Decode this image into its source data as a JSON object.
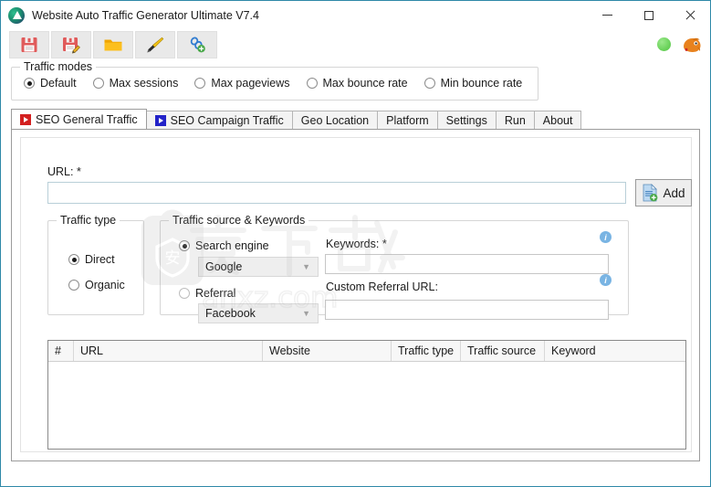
{
  "window": {
    "title": "Website Auto Traffic Generator Ultimate V7.4",
    "app_icon": "app-logo-icon",
    "minimize_label": "—",
    "maximize_label": "□",
    "close_label": "✕"
  },
  "toolbar": {
    "buttons": [
      {
        "name": "save-button",
        "icon": "floppy-disk-icon",
        "tooltip": "Save"
      },
      {
        "name": "save-as-button",
        "icon": "floppy-disk-edit-icon",
        "tooltip": "Save As"
      },
      {
        "name": "open-button",
        "icon": "folder-open-icon",
        "tooltip": "Open"
      },
      {
        "name": "highlighter-button",
        "icon": "flashlight-icon",
        "tooltip": "Highlight"
      },
      {
        "name": "add-link-button",
        "icon": "link-add-icon",
        "tooltip": "Add link"
      }
    ],
    "status_indicator": "green-status-dot",
    "mascot_icon": "dragon-mascot-icon"
  },
  "traffic_modes": {
    "legend": "Traffic modes",
    "options": [
      {
        "label": "Default",
        "selected": true
      },
      {
        "label": "Max sessions",
        "selected": false
      },
      {
        "label": "Max pageviews",
        "selected": false
      },
      {
        "label": "Max bounce rate",
        "selected": false
      },
      {
        "label": "Min bounce rate",
        "selected": false
      }
    ]
  },
  "tabs": [
    {
      "label": "SEO General Traffic",
      "icon": "play-red-icon",
      "active": true
    },
    {
      "label": "SEO Campaign Traffic",
      "icon": "play-blue-icon",
      "active": false
    },
    {
      "label": "Geo Location",
      "icon": "",
      "active": false
    },
    {
      "label": "Platform",
      "icon": "",
      "active": false
    },
    {
      "label": "Settings",
      "icon": "",
      "active": false
    },
    {
      "label": "Run",
      "icon": "",
      "active": false
    },
    {
      "label": "About",
      "icon": "",
      "active": false
    }
  ],
  "general_traffic": {
    "url_label": "URL: *",
    "url_value": "",
    "url_placeholder": "",
    "add_button_label": "Add",
    "add_button_icon": "document-add-icon",
    "traffic_type": {
      "legend": "Traffic type",
      "options": [
        {
          "label": "Direct",
          "selected": true
        },
        {
          "label": "Organic",
          "selected": false
        }
      ]
    },
    "traffic_source": {
      "legend": "Traffic source & Keywords",
      "search_engine": {
        "radio_label": "Search engine",
        "selected": true,
        "combo_value": "Google"
      },
      "referral": {
        "radio_label": "Referral",
        "selected": false,
        "combo_value": "Facebook"
      },
      "keywords_label": "Keywords: *",
      "keywords_value": "",
      "custom_referral_label": "Custom Referral URL:",
      "custom_referral_value": "",
      "info_icon": "info-circle-icon"
    },
    "grid": {
      "columns": [
        "#",
        "URL",
        "Website",
        "Traffic type",
        "Traffic source",
        "Keyword"
      ],
      "rows": []
    }
  },
  "watermark": {
    "text_cn": "安下载",
    "text_en": "anxz.com",
    "badge_char": "安"
  },
  "colors": {
    "window_border": "#2e88a8",
    "accent_info": "#79b4e3",
    "status_green": "#6cd35c",
    "tab_red": "#d32020",
    "tab_blue": "#2222c8",
    "field_border": "#b9cfd8"
  }
}
